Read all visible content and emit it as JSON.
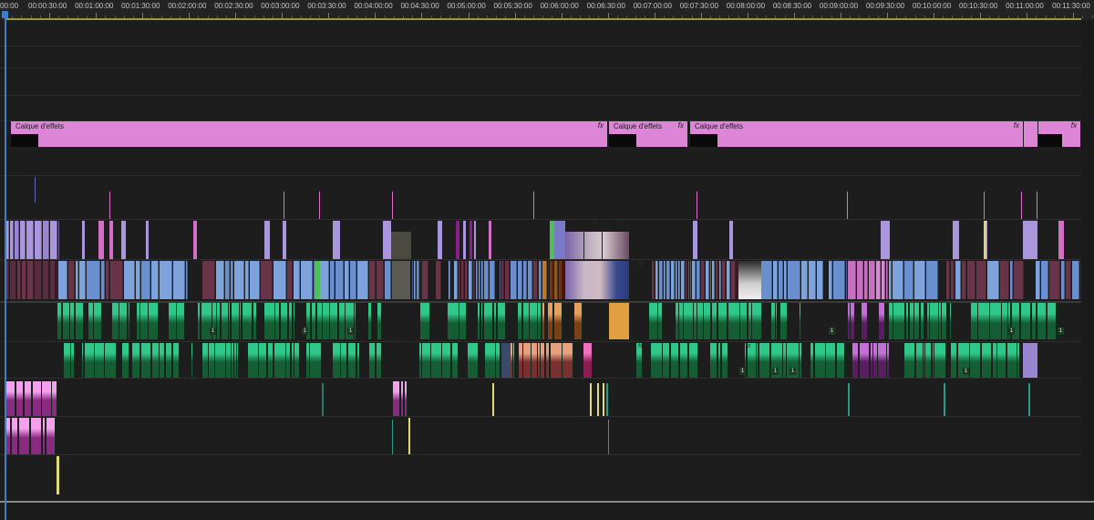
{
  "ruler": {
    "labels": [
      "00:00",
      "00:00:30:00",
      "00:01:00:00",
      "00:01:30:00",
      "00:02:00:00",
      "00:02:30:00",
      "00:03:00:00",
      "00:03:30:00",
      "00:04:00:00",
      "00:04:30:00",
      "00:05:00:00",
      "00:05:30:00",
      "00:06:00:00",
      "00:06:30:00",
      "00:07:00:00",
      "00:07:30:00",
      "00:08:00:00",
      "00:08:30:00",
      "00:09:00:00",
      "00:09:30:00",
      "00:10:00:00",
      "00:10:30:00",
      "00:11:00:00",
      "00:11:30:00"
    ]
  },
  "adjustment_layer": {
    "clips": [
      {
        "label": "Calque d'effets",
        "fx": "fx"
      },
      {
        "label": "Calque d'effets",
        "fx": "fx"
      },
      {
        "label": "Calque d'effets",
        "fx": "fx"
      },
      {
        "label": "",
        "fx": ""
      },
      {
        "label": "",
        "fx": "fx"
      }
    ]
  },
  "audio_badges": [
    "1",
    "1",
    "1",
    "1",
    "1",
    "1",
    "1",
    "1",
    "1",
    "1"
  ],
  "fx_tags": [
    "fx",
    "fx",
    "fx",
    "fx",
    "fx"
  ],
  "colors": {
    "adjustment": "#dd86d8",
    "video_lavender": "#a996dc",
    "video_blue": "#7ea2dc",
    "video_maroon": "#6a3448",
    "audio_green": "#2fc88a",
    "audio_dark": "#155e34",
    "audio_pink": "#e68fe0",
    "audio_yellow": "#e0dc78",
    "marker_pink": "#e070d0",
    "playhead": "#3d7cc9"
  }
}
